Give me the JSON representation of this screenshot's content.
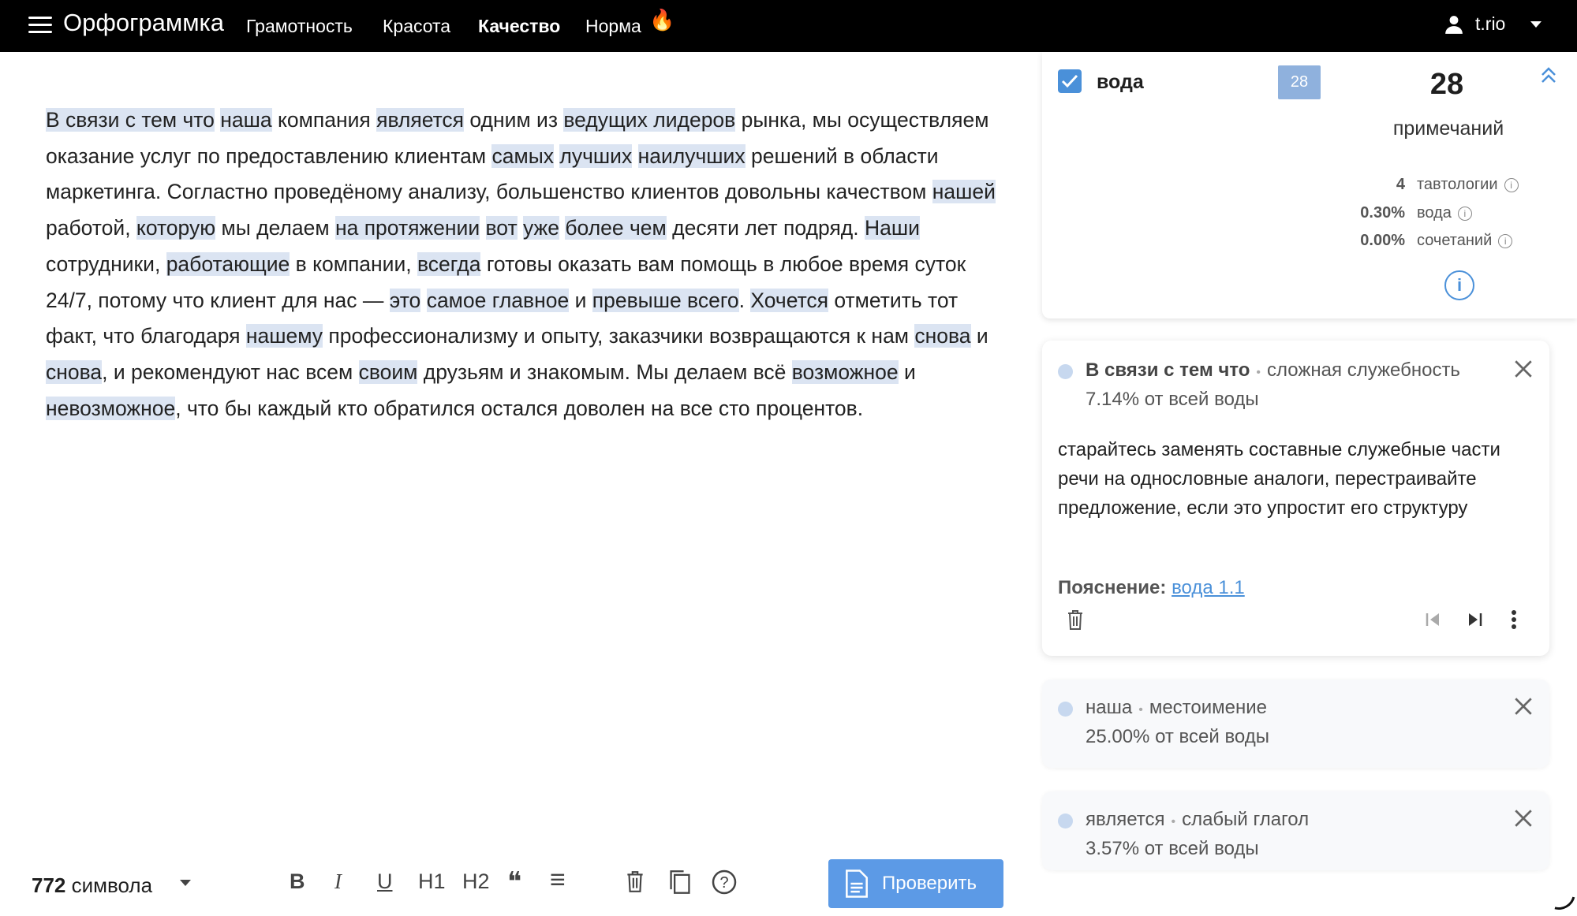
{
  "header": {
    "logo": "Орфограммка",
    "nav": [
      "Грамотность",
      "Красота",
      "Качество",
      "Норма"
    ],
    "active_nav": "Качество",
    "user": "t.rio"
  },
  "editor": {
    "segments": [
      {
        "t": "В связи с тем что",
        "h": true
      },
      {
        "t": " "
      },
      {
        "t": "наша",
        "h": true
      },
      {
        "t": " компания "
      },
      {
        "t": "является",
        "h": true
      },
      {
        "t": " одним из "
      },
      {
        "t": "ведущих лидеров",
        "h": true
      },
      {
        "t": " рынка, мы осуществляем оказание услуг по предоставлению клиентам "
      },
      {
        "t": "самых",
        "h": true
      },
      {
        "t": " "
      },
      {
        "t": "лучших",
        "h": true
      },
      {
        "t": " "
      },
      {
        "t": "наилучших",
        "h": true
      },
      {
        "t": " решений в области маркетинга. Согластно проведёному анализу, большенство клиентов довольны качеством "
      },
      {
        "t": "нашей",
        "h": true
      },
      {
        "t": " работой, "
      },
      {
        "t": "которую",
        "h": true
      },
      {
        "t": " мы делаем "
      },
      {
        "t": "на протяжении",
        "h": true
      },
      {
        "t": " "
      },
      {
        "t": "вот",
        "h": true
      },
      {
        "t": " "
      },
      {
        "t": "уже",
        "h": true
      },
      {
        "t": " "
      },
      {
        "t": "более чем",
        "h": true
      },
      {
        "t": " десяти лет подряд. "
      },
      {
        "t": "Наши",
        "h": true
      },
      {
        "t": " сотрудники, "
      },
      {
        "t": "работающие",
        "h": true
      },
      {
        "t": " в компании, "
      },
      {
        "t": "всегда",
        "h": true
      },
      {
        "t": " готовы оказать вам помощь в любое время суток 24/7, потому что клиент для нас — "
      },
      {
        "t": "это",
        "h": true
      },
      {
        "t": " "
      },
      {
        "t": "самое главное",
        "h": true
      },
      {
        "t": " и "
      },
      {
        "t": "превыше всего",
        "h": true
      },
      {
        "t": ". "
      },
      {
        "t": "Хочется",
        "h": true
      },
      {
        "t": " отметить тот факт, что благодаря "
      },
      {
        "t": "нашему",
        "h": true
      },
      {
        "t": " профессионализму и опыту, заказчики возвращаются к нам "
      },
      {
        "t": "снова",
        "h": true
      },
      {
        "t": " и "
      },
      {
        "t": "снова",
        "h": true
      },
      {
        "t": ", и рекомендуют нас всем "
      },
      {
        "t": "своим",
        "h": true
      },
      {
        "t": " друзьям и знакомым. Мы делаем всё "
      },
      {
        "t": "возможное",
        "h": true
      },
      {
        "t": " и "
      },
      {
        "t": "невозможное",
        "h": true
      },
      {
        "t": ", что бы каждый кто обратился остался доволен на все сто процентов."
      }
    ]
  },
  "bottom": {
    "char_count": "772",
    "char_label": " символа",
    "tools": [
      "B",
      "I",
      "U",
      "H1",
      "H2",
      "❝",
      "≡",
      "🗑",
      "⧉",
      "?"
    ],
    "check_button": "Проверить"
  },
  "summary": {
    "title": "вода",
    "badge": "28",
    "count": "28",
    "count_label": "примечаний",
    "metrics": [
      {
        "value": "4",
        "label": "тавтологии"
      },
      {
        "value": "0.30%",
        "label": "вода"
      },
      {
        "value": "0.00%",
        "label": "сочетаний"
      }
    ]
  },
  "cards": [
    {
      "word": "В связи с тем что",
      "type": "сложная служебность",
      "share": "7.14% от всей воды",
      "body": "старайтесь заменять составные служебные части речи на однословные аналоги, перестраивайте предложение, если это упростит его структуру",
      "explain_label": "Пояснение:",
      "explain_link": "вода 1.1"
    },
    {
      "word": "наша",
      "type": "местоимение",
      "share": "25.00% от всей воды"
    },
    {
      "word": "является",
      "type": "слабый глагол",
      "share": "3.57% от всей воды"
    }
  ],
  "colors": {
    "accent": "#4a90d9",
    "highlight": "#dbe4f2",
    "topbar": "#000000"
  }
}
